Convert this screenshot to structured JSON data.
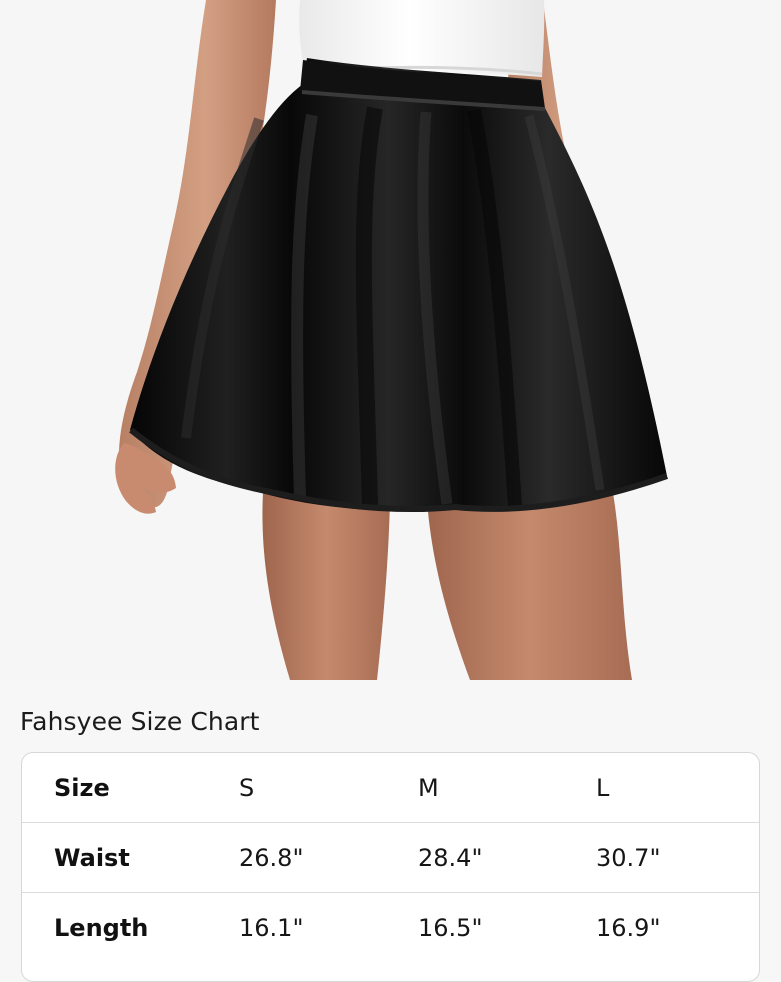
{
  "size_chart": {
    "title": "Fahsyee Size Chart",
    "header": {
      "label": "Size",
      "sizes": [
        "S",
        "M",
        "L"
      ]
    },
    "rows": [
      {
        "label": "Waist",
        "values": [
          "26.8\"",
          "28.4\"",
          "30.7\""
        ]
      },
      {
        "label": "Length",
        "values": [
          "16.1\"",
          "16.5\"",
          "16.9\""
        ]
      }
    ]
  },
  "colors": {
    "background": "#f7f7f7",
    "table_border": "#d7d7d7",
    "skirt": "#111111",
    "top": "#fafafa",
    "skin": "#c79174"
  }
}
